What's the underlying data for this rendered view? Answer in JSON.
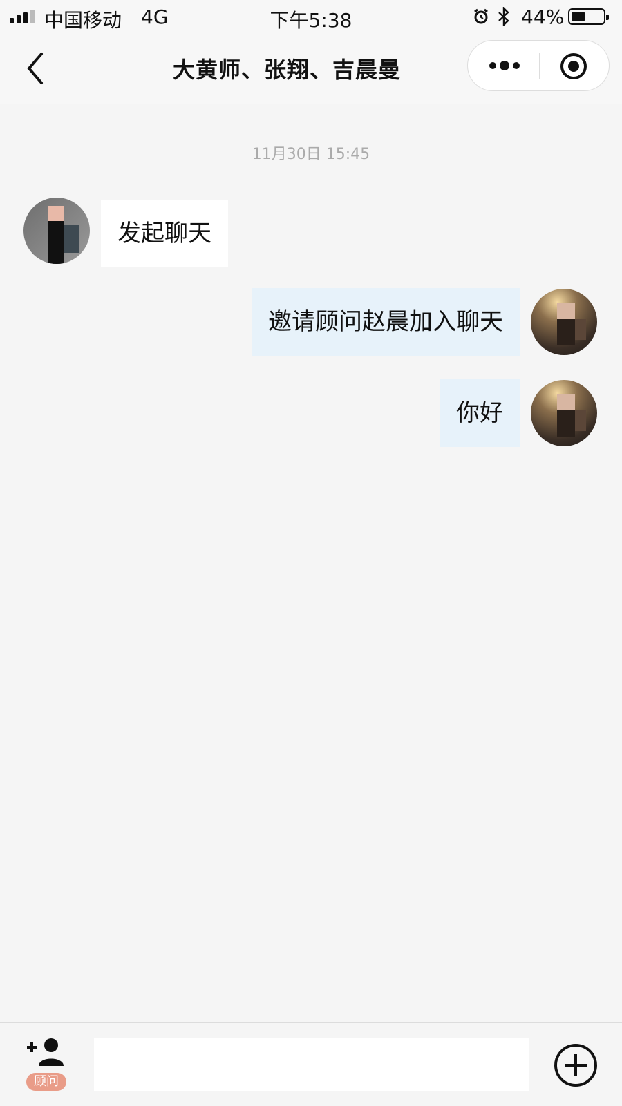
{
  "status_bar": {
    "carrier": "中国移动",
    "network": "4G",
    "time": "下午5:38",
    "battery_percent": "44%",
    "battery_level": 0.44,
    "icons": [
      "signal-icon",
      "alarm-icon",
      "bluetooth-icon",
      "battery-icon"
    ]
  },
  "nav": {
    "title": "大黄师、张翔、吉晨曼",
    "icons": [
      "back-icon",
      "more-icon",
      "target-icon"
    ]
  },
  "chat": {
    "timestamp": "11月30日 15:45",
    "messages": [
      {
        "side": "left",
        "text": "发起聊天"
      },
      {
        "side": "right",
        "text": "邀请顾问赵晨加入聊天"
      },
      {
        "side": "right",
        "text": "你好"
      }
    ]
  },
  "bottom_bar": {
    "advisor_badge": "顾问",
    "input_value": "",
    "icons": [
      "add-person-icon",
      "plus-circle-icon"
    ]
  },
  "colors": {
    "background": "#f5f5f5",
    "bubble_left": "#ffffff",
    "bubble_right": "#e7f2fa",
    "badge": "#e99c88"
  }
}
